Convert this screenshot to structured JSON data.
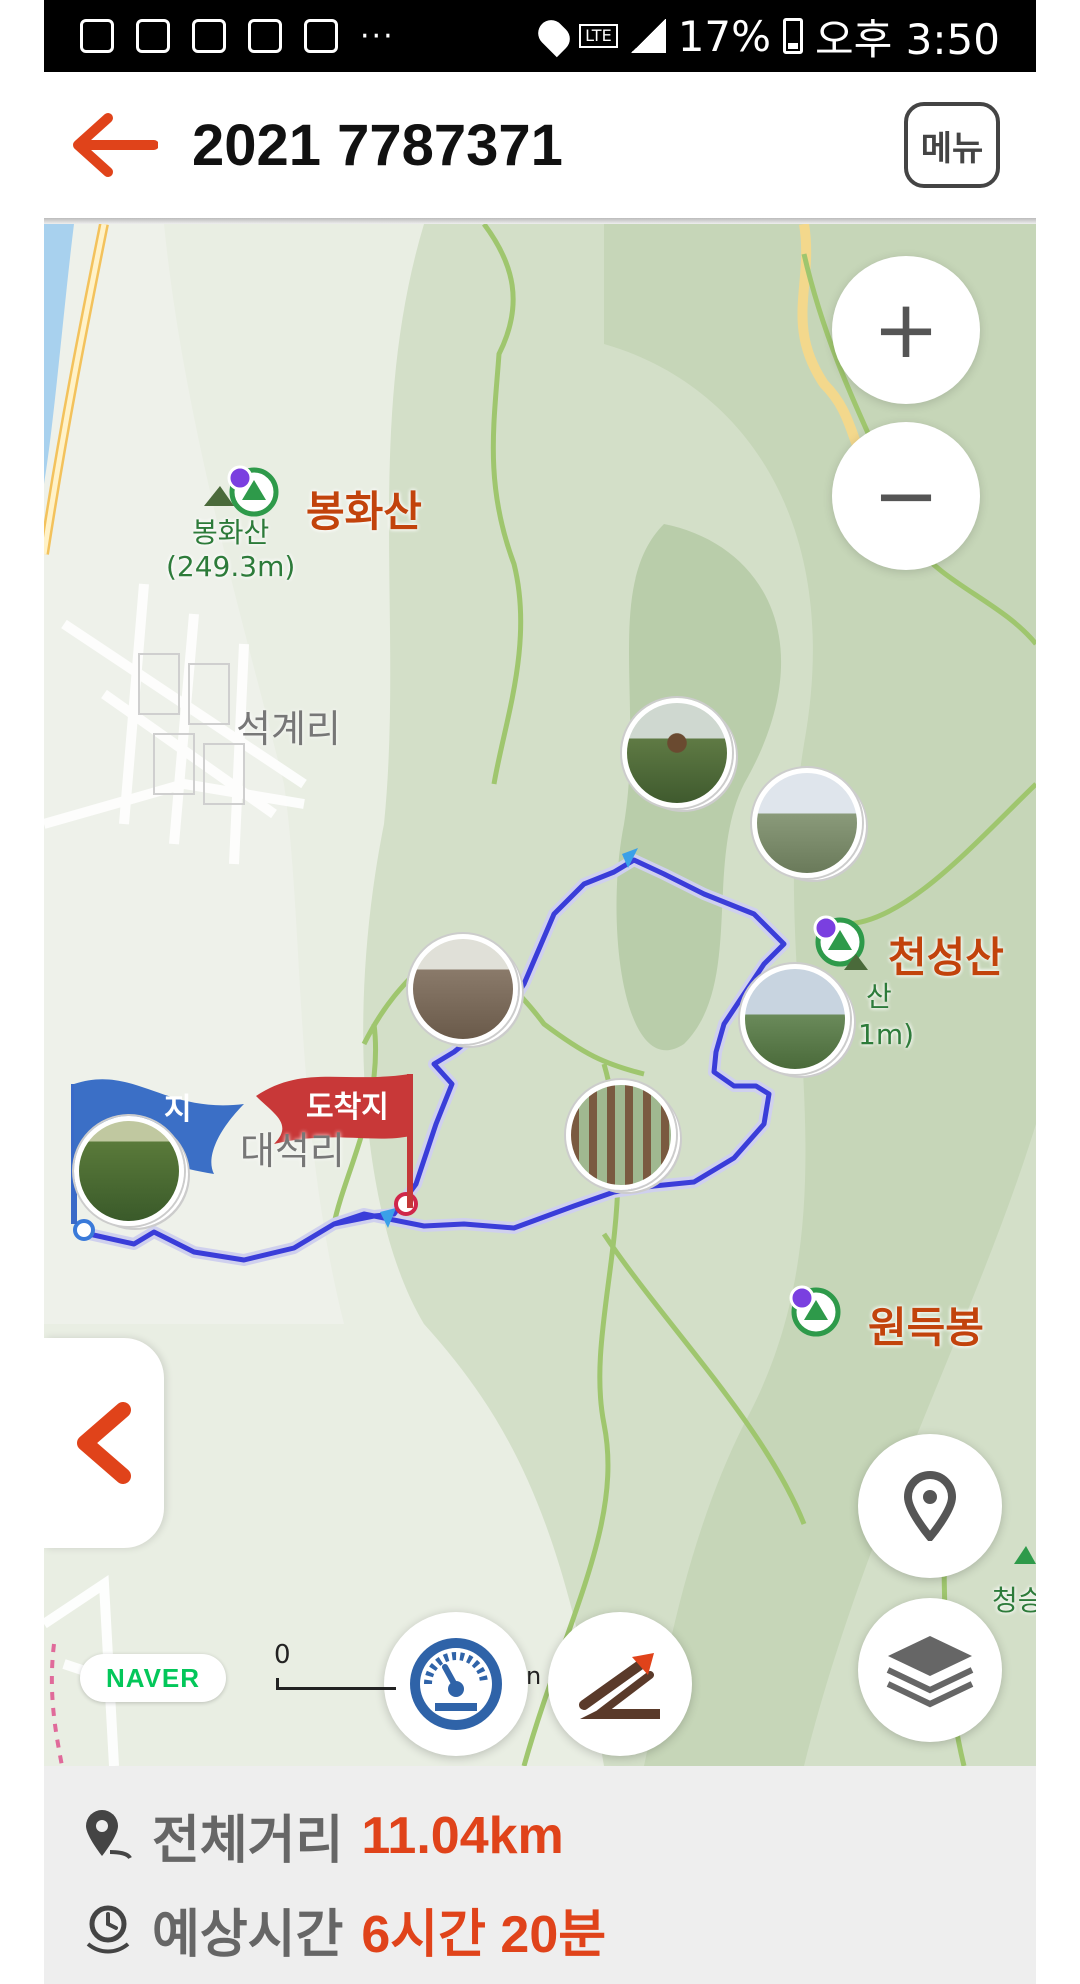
{
  "status_bar": {
    "battery": "17%",
    "time": "오후 3:50",
    "network": "LTE",
    "overflow": "···"
  },
  "header": {
    "title": "2021 7787371",
    "menu_label": "메뉴"
  },
  "map": {
    "zoom_in": "+",
    "zoom_out": "−",
    "labels": {
      "bonghwasan_big": "봉화산",
      "bonghwasan_small": "봉화산",
      "bonghwasan_height": "(249.3m)",
      "seokgyeri": "석계리",
      "daeseokri": "대석리",
      "cheonseongsan_big": "천성산",
      "cheonseongsan_small_partial": "산",
      "cheonseongsan_height_partial": "1m)",
      "wondeukbong": "원득봉",
      "cheong_partial": "청승"
    },
    "flags": {
      "start_partial": "지",
      "arrival": "도착지"
    },
    "scale_zero": "0",
    "scale_unit_partial": "n",
    "brand": "NAVER"
  },
  "summary": {
    "distance_label": "전체거리",
    "distance_value": "11.04km",
    "time_label": "예상시간",
    "time_value": "6시간 20분"
  },
  "colors": {
    "accent": "#e0431a",
    "route": "#3a3dd9",
    "map_bg": "#e9eee3"
  }
}
